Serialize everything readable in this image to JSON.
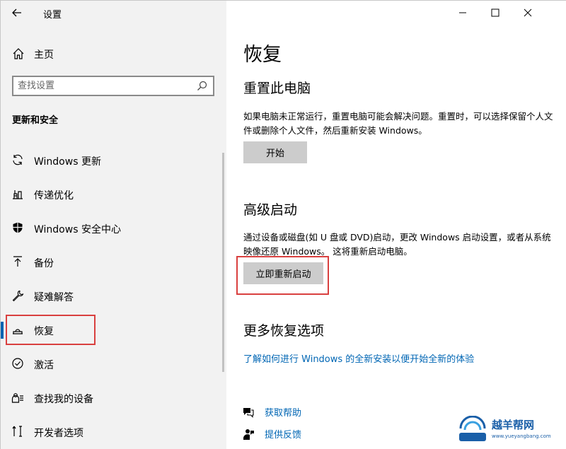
{
  "window": {
    "title": "设置",
    "controls": {
      "minimize": "minimize",
      "maximize": "maximize",
      "close": "close"
    }
  },
  "sidebar": {
    "home_label": "主页",
    "search_placeholder": "查找设置",
    "section_heading": "更新和安全",
    "items": [
      {
        "label": "Windows 更新",
        "icon": "sync-icon"
      },
      {
        "label": "传递优化",
        "icon": "delivery-optimization-icon"
      },
      {
        "label": "Windows 安全中心",
        "icon": "shield-icon"
      },
      {
        "label": "备份",
        "icon": "backup-arrow-icon"
      },
      {
        "label": "疑难解答",
        "icon": "wrench-icon"
      },
      {
        "label": "恢复",
        "icon": "recovery-icon",
        "selected": true
      },
      {
        "label": "激活",
        "icon": "check-circle-icon"
      },
      {
        "label": "查找我的设备",
        "icon": "find-device-icon"
      },
      {
        "label": "开发者选项",
        "icon": "developer-tools-icon"
      }
    ]
  },
  "main": {
    "page_title": "恢复",
    "reset": {
      "heading": "重置此电脑",
      "description": "如果电脑未正常运行，重置电脑可能会解决问题。重置时，可以选择保留个人文件或删除个人文件，然后重新安装 Windows。",
      "button": "开始"
    },
    "advanced": {
      "heading": "高级启动",
      "description": "通过设备或磁盘(如 U 盘或 DVD)启动，更改 Windows 启动设置，或者从系统映像还原 Windows。 这将重新启动电脑。",
      "button": "立即重新启动"
    },
    "more": {
      "heading": "更多恢复选项",
      "link": "了解如何进行 Windows 的全新安装以便开始全新的体验"
    },
    "help": {
      "get_help": "获取帮助",
      "feedback": "提供反馈"
    }
  },
  "watermark": {
    "text": "越羊帮网",
    "sub": "www.yueyangbang.com"
  },
  "colors": {
    "accent": "#0063b1",
    "link": "#0066b4",
    "highlight": "#d9403f",
    "sidebar_bg": "#f2f2f2",
    "button_bg": "#cccccc"
  }
}
